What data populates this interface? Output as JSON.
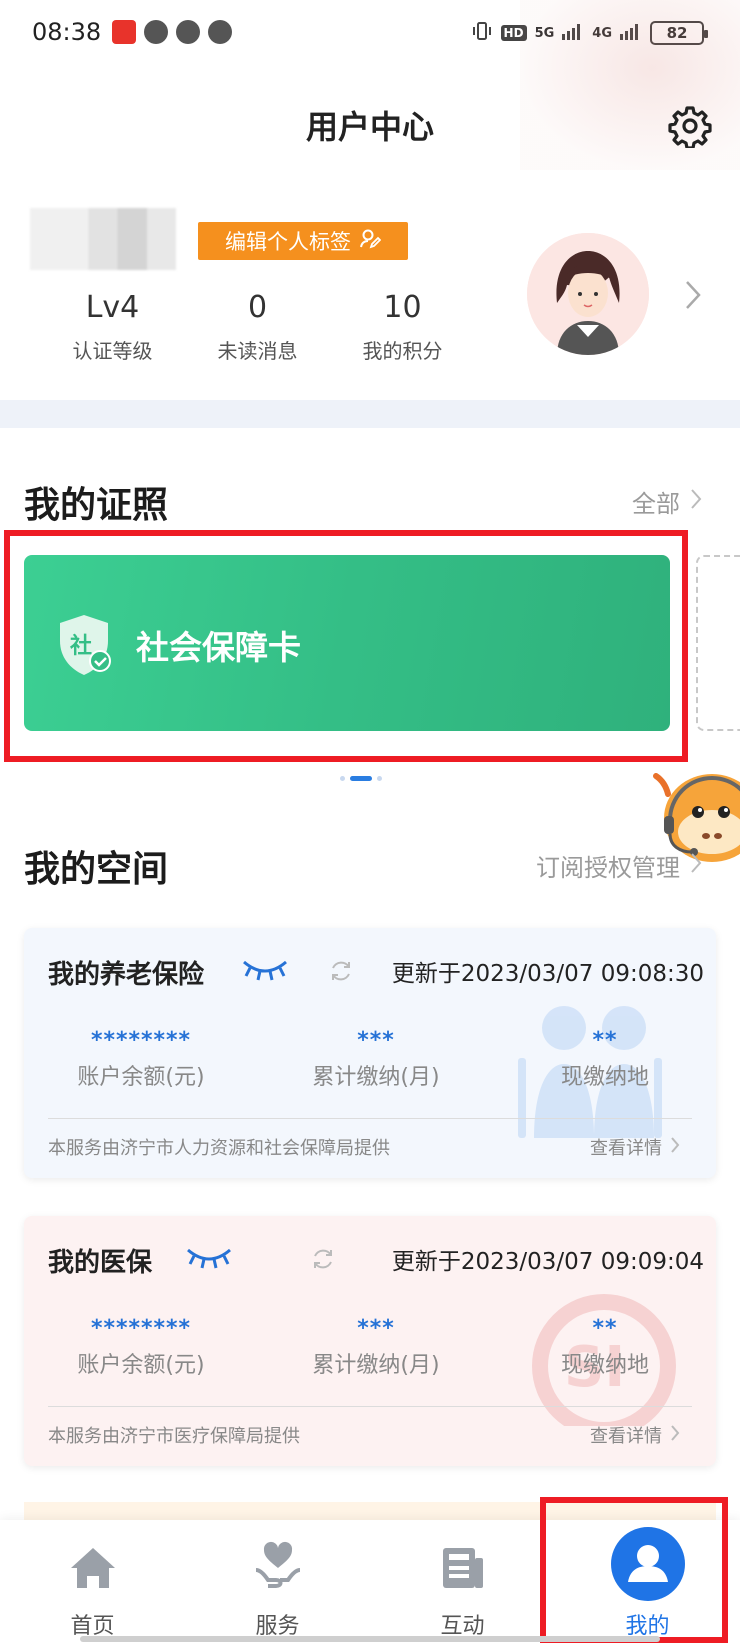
{
  "status_bar": {
    "time": "08:38",
    "battery": "82",
    "net1": "5G",
    "net2": "4G",
    "hd": "HD"
  },
  "header": {
    "title": "用户中心"
  },
  "profile": {
    "tag_button": "编辑个人标签",
    "stats": [
      {
        "value": "Lv4",
        "label": "认证等级"
      },
      {
        "value": "0",
        "label": "未读消息"
      },
      {
        "value": "10",
        "label": "我的积分"
      }
    ]
  },
  "licenses": {
    "title": "我的证照",
    "all_link": "全部",
    "card_label": "社会保障卡"
  },
  "space": {
    "title": "我的空间",
    "manage_link": "订阅授权管理",
    "pension": {
      "title": "我的养老保险",
      "updated": "更新于2023/03/07 09:08:30",
      "cols": [
        {
          "value": "********",
          "label": "账户余额(元)"
        },
        {
          "value": "***",
          "label": "累计缴纳(月)"
        },
        {
          "value": "**",
          "label": "现缴纳地"
        }
      ],
      "provider": "本服务由济宁市人力资源和社会保障局提供",
      "details": "查看详情"
    },
    "medical": {
      "title": "我的医保",
      "updated": "更新于2023/03/07 09:09:04",
      "cols": [
        {
          "value": "********",
          "label": "账户余额(元)"
        },
        {
          "value": "***",
          "label": "累计缴纳(月)"
        },
        {
          "value": "**",
          "label": "现缴纳地"
        }
      ],
      "provider": "本服务由济宁市医疗保障局提供",
      "details": "查看详情"
    }
  },
  "tabbar": {
    "items": [
      {
        "label": "首页",
        "icon": "home-icon"
      },
      {
        "label": "服务",
        "icon": "service-heart-icon"
      },
      {
        "label": "互动",
        "icon": "news-icon"
      },
      {
        "label": "我的",
        "icon": "user-icon"
      }
    ],
    "active_index": 3
  },
  "colors": {
    "accent": "#1f74e6",
    "card_green": "#34be86",
    "tag_orange": "#f5901e",
    "highlight_red": "#ee1c24"
  }
}
